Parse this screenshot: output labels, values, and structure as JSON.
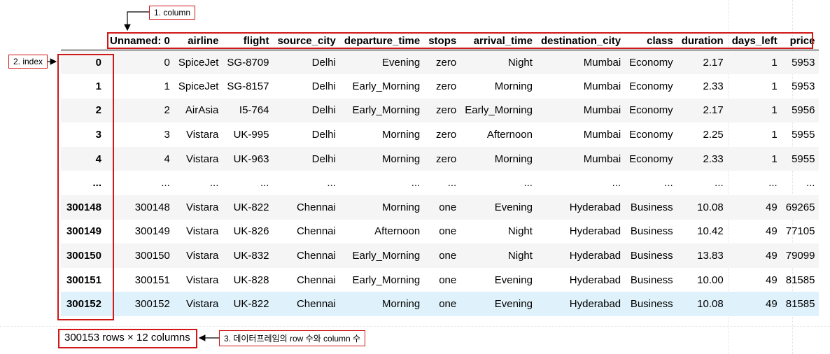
{
  "annotations": {
    "column": "1. column",
    "index": "2. index",
    "shape": "3. 데이터프레임의 row 수와 column 수"
  },
  "table": {
    "columns": [
      "Unnamed: 0",
      "airline",
      "flight",
      "source_city",
      "departure_time",
      "stops",
      "arrival_time",
      "destination_city",
      "class",
      "duration",
      "days_left",
      "price"
    ],
    "rows": [
      {
        "index": "0",
        "cells": [
          "0",
          "SpiceJet",
          "SG-8709",
          "Delhi",
          "Evening",
          "zero",
          "Night",
          "Mumbai",
          "Economy",
          "2.17",
          "1",
          "5953"
        ]
      },
      {
        "index": "1",
        "cells": [
          "1",
          "SpiceJet",
          "SG-8157",
          "Delhi",
          "Early_Morning",
          "zero",
          "Morning",
          "Mumbai",
          "Economy",
          "2.33",
          "1",
          "5953"
        ]
      },
      {
        "index": "2",
        "cells": [
          "2",
          "AirAsia",
          "I5-764",
          "Delhi",
          "Early_Morning",
          "zero",
          "Early_Morning",
          "Mumbai",
          "Economy",
          "2.17",
          "1",
          "5956"
        ]
      },
      {
        "index": "3",
        "cells": [
          "3",
          "Vistara",
          "UK-995",
          "Delhi",
          "Morning",
          "zero",
          "Afternoon",
          "Mumbai",
          "Economy",
          "2.25",
          "1",
          "5955"
        ]
      },
      {
        "index": "4",
        "cells": [
          "4",
          "Vistara",
          "UK-963",
          "Delhi",
          "Morning",
          "zero",
          "Morning",
          "Mumbai",
          "Economy",
          "2.33",
          "1",
          "5955"
        ]
      },
      {
        "index": "...",
        "cells": [
          "...",
          "...",
          "...",
          "...",
          "...",
          "...",
          "...",
          "...",
          "...",
          "...",
          "...",
          "..."
        ]
      },
      {
        "index": "300148",
        "cells": [
          "300148",
          "Vistara",
          "UK-822",
          "Chennai",
          "Morning",
          "one",
          "Evening",
          "Hyderabad",
          "Business",
          "10.08",
          "49",
          "69265"
        ]
      },
      {
        "index": "300149",
        "cells": [
          "300149",
          "Vistara",
          "UK-826",
          "Chennai",
          "Afternoon",
          "one",
          "Night",
          "Hyderabad",
          "Business",
          "10.42",
          "49",
          "77105"
        ]
      },
      {
        "index": "300150",
        "cells": [
          "300150",
          "Vistara",
          "UK-832",
          "Chennai",
          "Early_Morning",
          "one",
          "Night",
          "Hyderabad",
          "Business",
          "13.83",
          "49",
          "79099"
        ]
      },
      {
        "index": "300151",
        "cells": [
          "300151",
          "Vistara",
          "UK-828",
          "Chennai",
          "Early_Morning",
          "one",
          "Evening",
          "Hyderabad",
          "Business",
          "10.00",
          "49",
          "81585"
        ]
      },
      {
        "index": "300152",
        "cells": [
          "300152",
          "Vistara",
          "UK-822",
          "Chennai",
          "Morning",
          "one",
          "Evening",
          "Hyderabad",
          "Business",
          "10.08",
          "49",
          "81585"
        ]
      }
    ],
    "summary": "300153 rows × 12 columns"
  },
  "colors": {
    "annotation": "#d01818",
    "stripe": "#f5f5f5",
    "hover_row": "#dff2fb"
  }
}
